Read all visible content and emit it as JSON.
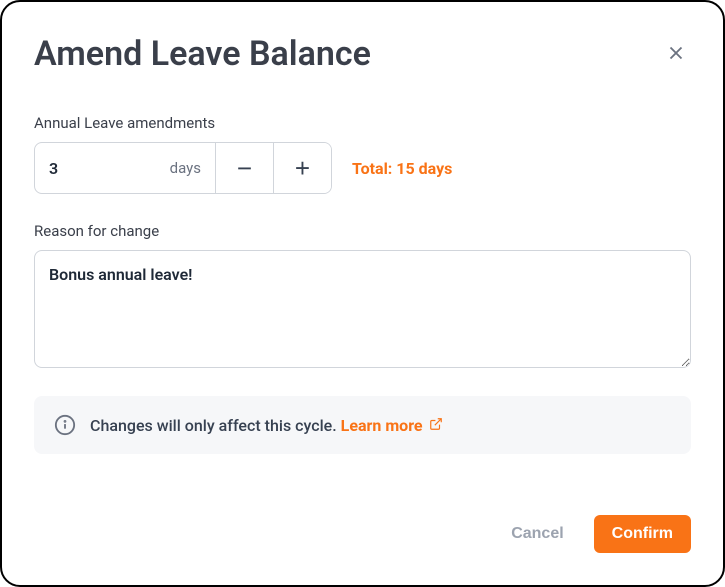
{
  "modal": {
    "title": "Amend Leave Balance"
  },
  "amendment": {
    "label": "Annual Leave amendments",
    "value": "3",
    "unit": "days",
    "total_label": "Total: 15 days"
  },
  "reason": {
    "label": "Reason for change",
    "value": "Bonus annual leave!"
  },
  "info": {
    "text": "Changes will only affect this cycle. ",
    "learn_more": "Learn more"
  },
  "footer": {
    "cancel": "Cancel",
    "confirm": "Confirm"
  }
}
